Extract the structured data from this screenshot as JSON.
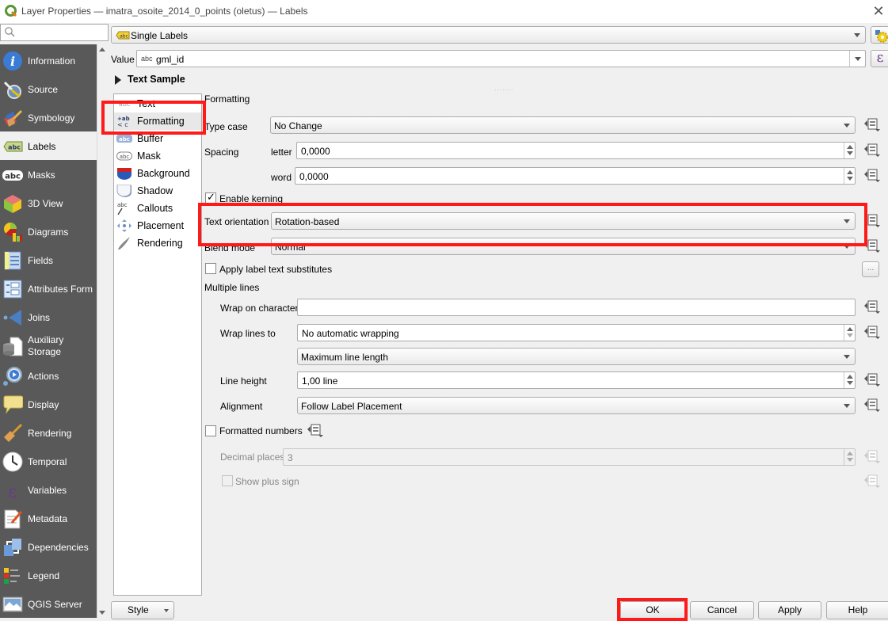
{
  "window": {
    "title": "Layer Properties — imatra_osoite_2014_0_points (oletus) — Labels",
    "close_glyph": "✕"
  },
  "sidebar": {
    "search_placeholder": "",
    "items": [
      {
        "label": "Information",
        "icon": "information-icon"
      },
      {
        "label": "Source",
        "icon": "source-icon"
      },
      {
        "label": "Symbology",
        "icon": "symbology-icon"
      },
      {
        "label": "Labels",
        "icon": "labels-icon",
        "active": true
      },
      {
        "label": "Masks",
        "icon": "masks-icon"
      },
      {
        "label": "3D View",
        "icon": "3d-view-icon"
      },
      {
        "label": "Diagrams",
        "icon": "diagrams-icon"
      },
      {
        "label": "Fields",
        "icon": "fields-icon"
      },
      {
        "label": "Attributes Form",
        "icon": "attributes-form-icon"
      },
      {
        "label": "Joins",
        "icon": "joins-icon"
      },
      {
        "label": "Auxiliary\nStorage",
        "icon": "auxiliary-storage-icon"
      },
      {
        "label": "Actions",
        "icon": "actions-icon"
      },
      {
        "label": "Display",
        "icon": "display-icon"
      },
      {
        "label": "Rendering",
        "icon": "rendering-icon"
      },
      {
        "label": "Temporal",
        "icon": "temporal-icon"
      },
      {
        "label": "Variables",
        "icon": "variables-icon"
      },
      {
        "label": "Metadata",
        "icon": "metadata-icon"
      },
      {
        "label": "Dependencies",
        "icon": "dependencies-icon"
      },
      {
        "label": "Legend",
        "icon": "legend-icon"
      },
      {
        "label": "QGIS Server",
        "icon": "qgis-server-icon"
      }
    ]
  },
  "labels_mode": {
    "selected": "Single Labels"
  },
  "value": {
    "label": "Value",
    "field_type": "abc",
    "field": "gml_id",
    "expression_glyph": "ε"
  },
  "text_sample": {
    "label": "Text Sample"
  },
  "tabs": [
    {
      "label": "Text"
    },
    {
      "label": "Formatting",
      "active": true
    },
    {
      "label": "Buffer"
    },
    {
      "label": "Mask"
    },
    {
      "label": "Background"
    },
    {
      "label": "Shadow"
    },
    {
      "label": "Callouts"
    },
    {
      "label": "Placement"
    },
    {
      "label": "Rendering"
    }
  ],
  "formatting": {
    "section_title": "Formatting",
    "type_case": {
      "label": "Type case",
      "value": "No Change"
    },
    "spacing": {
      "label": "Spacing",
      "letter_label": "letter",
      "letter_value": "0,0000",
      "word_label": "word",
      "word_value": "0,0000"
    },
    "enable_kerning": {
      "label": "Enable kerning",
      "checked": true
    },
    "text_orientation": {
      "label": "Text orientation",
      "value": "Rotation-based"
    },
    "blend_mode": {
      "label": "Blend mode",
      "value": "Normal"
    },
    "apply_substitutes": {
      "label": "Apply label text substitutes",
      "checked": false,
      "button": "..."
    },
    "multiple_lines": {
      "title": "Multiple lines",
      "wrap_on_character": {
        "label": "Wrap on character",
        "value": ""
      },
      "wrap_lines_to": {
        "label": "Wrap lines to",
        "value": "No automatic wrapping"
      },
      "wrap_mode": {
        "value": "Maximum line length"
      },
      "line_height": {
        "label": "Line height",
        "value": "1,00 line"
      },
      "alignment": {
        "label": "Alignment",
        "value": "Follow Label Placement"
      }
    },
    "formatted_numbers": {
      "label": "Formatted numbers",
      "checked": false
    },
    "decimal_places": {
      "label": "Decimal places",
      "value": "3"
    },
    "show_plus_sign": {
      "label": "Show plus sign",
      "checked": false
    }
  },
  "footer": {
    "style": "Style",
    "ok": "OK",
    "cancel": "Cancel",
    "apply": "Apply",
    "help": "Help"
  },
  "colors": {
    "highlight": "#ff1a1a",
    "sidebar_bg": "#595959"
  }
}
